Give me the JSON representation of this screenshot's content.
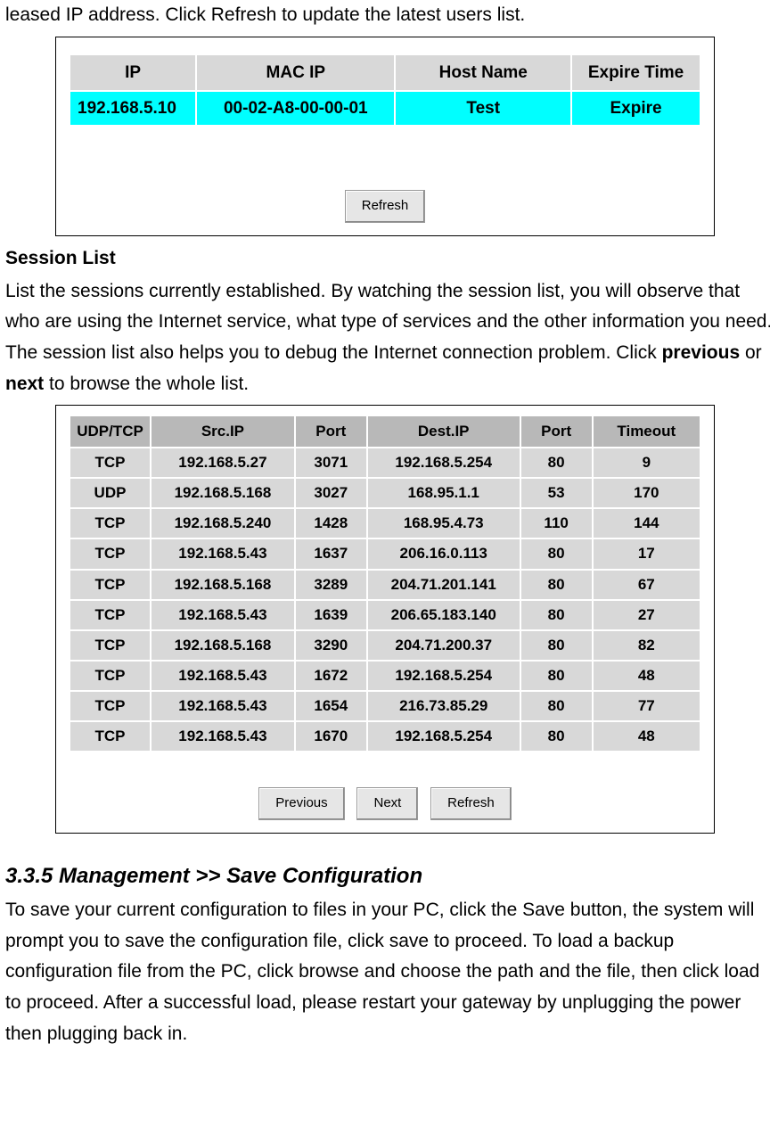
{
  "intro_text": "leased IP address. Click Refresh to update the latest users list.",
  "dhcp_table": {
    "headers": [
      "IP",
      "MAC IP",
      "Host Name",
      "Expire Time"
    ],
    "rows": [
      {
        "ip": "192.168.5.10",
        "mac": "00-02-A8-00-00-01",
        "host": "Test",
        "expire": "Expire"
      }
    ],
    "refresh_label": "Refresh"
  },
  "session_heading": "Session List",
  "session_text_before_prev": "List the sessions currently established. By watching the session list, you will observe that who are using the Internet service, what type of services and the other information you need. The session list also helps you to debug the Internet connection problem. Click ",
  "session_prev_word": "previous",
  "session_text_middle": " or ",
  "session_next_word": "next",
  "session_text_after_next": " to browse the whole list.",
  "session_table": {
    "headers": [
      "UDP/TCP",
      "Src.IP",
      "Port",
      "Dest.IP",
      "Port",
      "Timeout"
    ],
    "rows": [
      {
        "proto": "TCP",
        "srcip": "192.168.5.27",
        "sport": "3071",
        "destip": "192.168.5.254",
        "dport": "80",
        "timeout": "9"
      },
      {
        "proto": "UDP",
        "srcip": "192.168.5.168",
        "sport": "3027",
        "destip": "168.95.1.1",
        "dport": "53",
        "timeout": "170"
      },
      {
        "proto": "TCP",
        "srcip": "192.168.5.240",
        "sport": "1428",
        "destip": "168.95.4.73",
        "dport": "110",
        "timeout": "144"
      },
      {
        "proto": "TCP",
        "srcip": "192.168.5.43",
        "sport": "1637",
        "destip": "206.16.0.113",
        "dport": "80",
        "timeout": "17"
      },
      {
        "proto": "TCP",
        "srcip": "192.168.5.168",
        "sport": "3289",
        "destip": "204.71.201.141",
        "dport": "80",
        "timeout": "67"
      },
      {
        "proto": "TCP",
        "srcip": "192.168.5.43",
        "sport": "1639",
        "destip": "206.65.183.140",
        "dport": "80",
        "timeout": "27"
      },
      {
        "proto": "TCP",
        "srcip": "192.168.5.168",
        "sport": "3290",
        "destip": "204.71.200.37",
        "dport": "80",
        "timeout": "82"
      },
      {
        "proto": "TCP",
        "srcip": "192.168.5.43",
        "sport": "1672",
        "destip": "192.168.5.254",
        "dport": "80",
        "timeout": "48"
      },
      {
        "proto": "TCP",
        "srcip": "192.168.5.43",
        "sport": "1654",
        "destip": "216.73.85.29",
        "dport": "80",
        "timeout": "77"
      },
      {
        "proto": "TCP",
        "srcip": "192.168.5.43",
        "sport": "1670",
        "destip": "192.168.5.254",
        "dport": "80",
        "timeout": "48"
      }
    ],
    "previous_label": "Previous",
    "next_label": "Next",
    "refresh_label": "Refresh"
  },
  "save_heading": "3.3.5 Management >> Save Configuration",
  "save_text": "To save your current configuration to files in your PC, click the Save button, the system will prompt you to save the configuration file, click save to proceed. To load a backup configuration file from the PC, click browse and choose the path and the file, then click load to proceed. After a successful load, please restart your gateway by unplugging the power then plugging back in."
}
